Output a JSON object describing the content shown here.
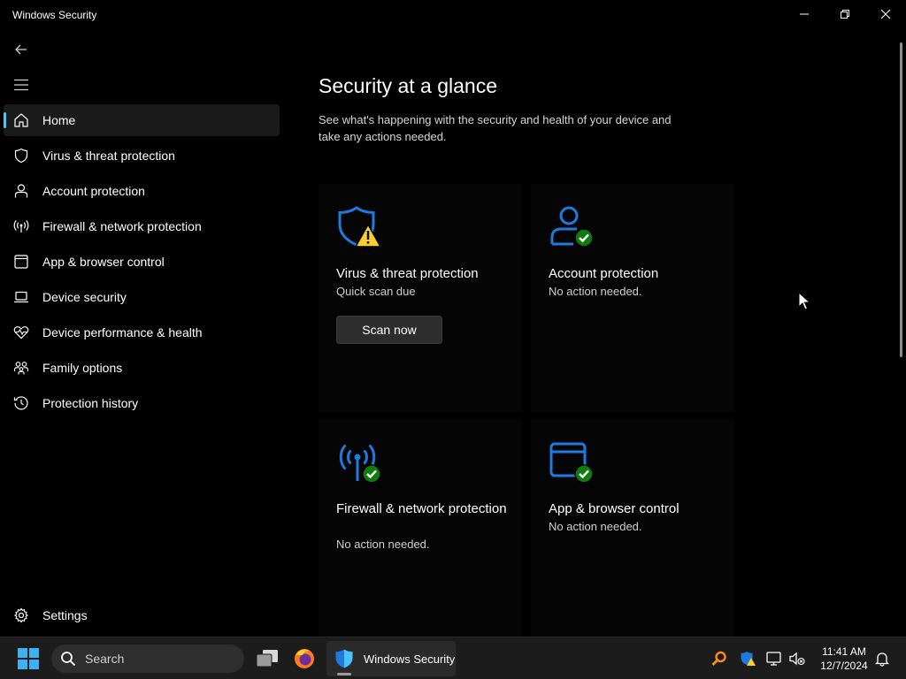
{
  "window": {
    "title": "Windows Security"
  },
  "sidebar": {
    "items": [
      {
        "label": "Home",
        "icon": "home-icon"
      },
      {
        "label": "Virus & threat protection",
        "icon": "shield-icon"
      },
      {
        "label": "Account protection",
        "icon": "person-icon"
      },
      {
        "label": "Firewall & network protection",
        "icon": "antenna-icon"
      },
      {
        "label": "App & browser control",
        "icon": "app-window-icon"
      },
      {
        "label": "Device security",
        "icon": "laptop-icon"
      },
      {
        "label": "Device performance & health",
        "icon": "heart-pulse-icon"
      },
      {
        "label": "Family options",
        "icon": "family-icon"
      },
      {
        "label": "Protection history",
        "icon": "history-icon"
      }
    ],
    "settings_label": "Settings"
  },
  "main": {
    "title": "Security at a glance",
    "subtitle": "See what's happening with the security and health of your device and take any actions needed.",
    "cards": [
      {
        "title": "Virus & threat protection",
        "status": "Quick scan due",
        "button": "Scan now"
      },
      {
        "title": "Account protection",
        "status": "No action needed."
      },
      {
        "title": "Firewall & network protection",
        "status": "No action needed."
      },
      {
        "title": "App & browser control",
        "status": "No action needed."
      }
    ]
  },
  "taskbar": {
    "search_placeholder": "Search",
    "active_app": "Windows Security",
    "time": "11:41 AM",
    "date": "12/7/2024"
  },
  "colors": {
    "accent": "#4cc2ff",
    "icon_blue": "#1f7ae0",
    "ok_green": "#0f7b0f",
    "warn_yellow": "#f8d22a"
  }
}
